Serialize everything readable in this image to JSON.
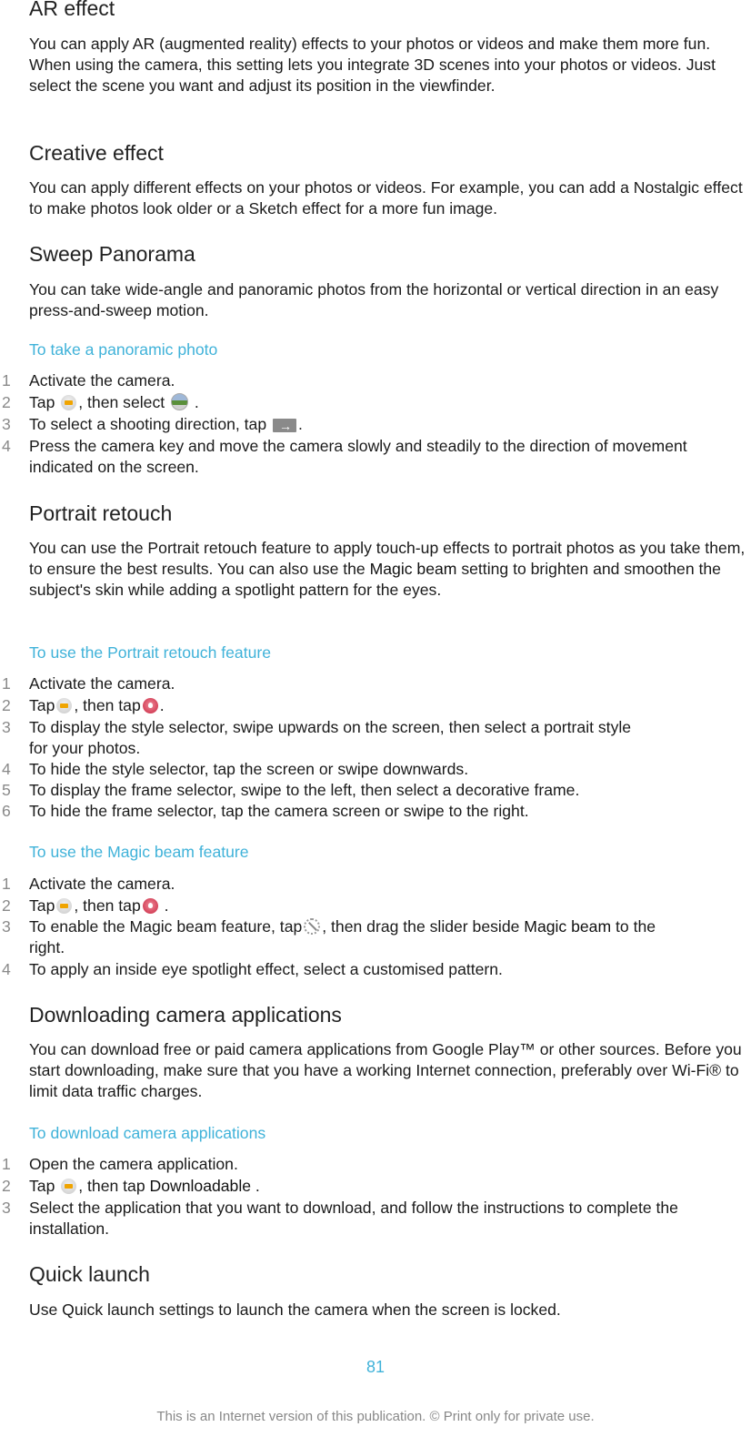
{
  "sections": {
    "ar": {
      "title": "AR effect",
      "body": "You can apply AR (augmented reality) effects to your photos or videos and make them more fun. When using the camera, this setting lets you integrate 3D scenes into your photos or videos. Just select the scene you want and adjust its position in the viewfinder."
    },
    "creative": {
      "title": "Creative effect",
      "body": "You can apply different effects on your photos or videos. For example, you can add a Nostalgic effect to make photos look older or a Sketch effect for a more fun image."
    },
    "sweep": {
      "title": "Sweep Panorama",
      "body": "You can take wide-angle and panoramic photos from the horizontal or vertical direction in an easy press-and-sweep motion.",
      "procedure_title": "To take a panoramic photo",
      "steps": [
        {
          "num": "1",
          "text": "Activate the camera."
        },
        {
          "num": "2",
          "pre": "Tap ",
          "mid": ", then select ",
          "post": " ."
        },
        {
          "num": "3",
          "pre": "To select a shooting direction, tap ",
          "post": "."
        },
        {
          "num": "4",
          "text": "Press the camera key and move the camera slowly and steadily to the direction of movement indicated on the screen."
        }
      ]
    },
    "portrait": {
      "title": "Portrait retouch",
      "body_pre": "You can use the Portrait retouch feature to apply touch-up effects to portrait photos as you take them, to ensure the best results. You can also use the ",
      "body_term": "Magic beam",
      "body_post": " setting to brighten and smoothen the subject's skin while adding a spotlight pattern for the eyes.",
      "procedure_title": "To use the Portrait retouch feature",
      "steps": [
        {
          "num": "1",
          "text": "Activate the camera."
        },
        {
          "num": "2",
          "pre": "Tap",
          "mid": ", then tap",
          "post": "."
        },
        {
          "num": "3",
          "text": "To display the style selector, swipe upwards on the screen, then select a portrait style for your photos."
        },
        {
          "num": "4",
          "text": "To hide the style selector, tap the screen or swipe downwards."
        },
        {
          "num": "5",
          "text": "To display the frame selector, swipe to the left, then select a decorative frame."
        },
        {
          "num": "6",
          "text": "To hide the frame selector, tap the camera screen or swipe to the right."
        }
      ]
    },
    "magic": {
      "procedure_title": "To use the Magic beam feature",
      "steps": [
        {
          "num": "1",
          "text": "Activate the camera."
        },
        {
          "num": "2",
          "pre": "Tap",
          "mid": ", then tap",
          "post": " ."
        },
        {
          "num": "3",
          "pre": "To enable the Magic beam feature, tap",
          "mid": ", then drag the slider beside ",
          "term": "Magic beam",
          "post": " to the right."
        },
        {
          "num": "4",
          "text": "To apply an inside eye spotlight effect, select a customised pattern."
        }
      ]
    },
    "download": {
      "title": "Downloading camera applications",
      "body": "You can download free or paid camera applications from Google Play™ or other sources. Before you start downloading, make sure that you have a working Internet connection, preferably over Wi-Fi® to limit data traffic charges.",
      "procedure_title": "To download camera applications",
      "steps": [
        {
          "num": "1",
          "text": "Open the camera application."
        },
        {
          "num": "2",
          "pre": "Tap ",
          "mid": ", then tap ",
          "term": "Downloadable",
          "post": " ."
        },
        {
          "num": "3",
          "text": "Select the application that you want to download, and follow the instructions to complete the installation."
        }
      ]
    },
    "quick": {
      "title": "Quick launch",
      "body": "Use Quick launch settings to launch the camera when the screen is locked."
    }
  },
  "page_number": "81",
  "footer": "This is an Internet version of this publication. © Print only for private use.",
  "icons": {
    "camera_settings": "camera-settings-icon",
    "panorama": "sweep-panorama-icon",
    "direction": "shooting-direction-icon",
    "portrait": "portrait-retouch-icon",
    "magic_beam": "magic-beam-icon"
  },
  "colors": {
    "accent": "#3fb2d9",
    "step_number": "#8a8a8a"
  }
}
